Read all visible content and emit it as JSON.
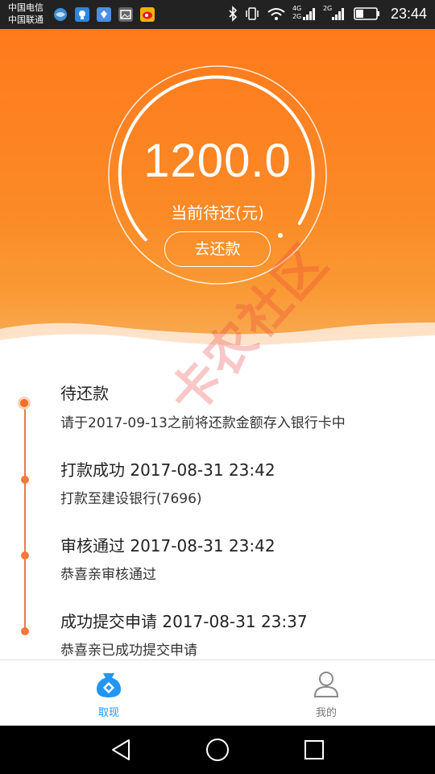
{
  "status_bar": {
    "carrier_1": "中国电信",
    "carrier_2": "中国联通",
    "net_1_top": "4G",
    "net_1_bottom": "2G",
    "net_2_top": "2G",
    "time": "23:44",
    "icons": [
      "globe-icon",
      "app-icon",
      "app-icon",
      "image-icon",
      "weibo-icon",
      "bluetooth-icon",
      "vibrate-icon",
      "wifi-icon",
      "signal-icon",
      "signal-icon",
      "battery-icon"
    ]
  },
  "hero": {
    "amount": "1200.0",
    "amount_label": "当前待还(元)",
    "repay_button": "去还款",
    "colors": {
      "gradient_top": "#ff7a1c",
      "gradient_bottom": "#f8b060"
    }
  },
  "timeline": {
    "accent_color": "#f4793a",
    "events": [
      {
        "title": "待还款",
        "detail": "请于2017-09-13之前将还款金额存入银行卡中"
      },
      {
        "title": "打款成功 2017-08-31 23:42",
        "detail": "打款至建设银行(7696)"
      },
      {
        "title": "审核通过 2017-08-31 23:42",
        "detail": "恭喜亲审核通过"
      },
      {
        "title": "成功提交申请 2017-08-31 23:37",
        "detail": "恭喜亲已成功提交申请"
      }
    ]
  },
  "watermark": {
    "text": "卡农社区"
  },
  "bottom_nav": {
    "active_color": "#2196f3",
    "items": [
      {
        "label": "取现",
        "icon": "money-bag-icon",
        "active": true
      },
      {
        "label": "我的",
        "icon": "user-icon",
        "active": false
      }
    ]
  },
  "system_nav": {
    "icons": [
      "back-icon",
      "home-icon",
      "recent-apps-icon"
    ]
  }
}
